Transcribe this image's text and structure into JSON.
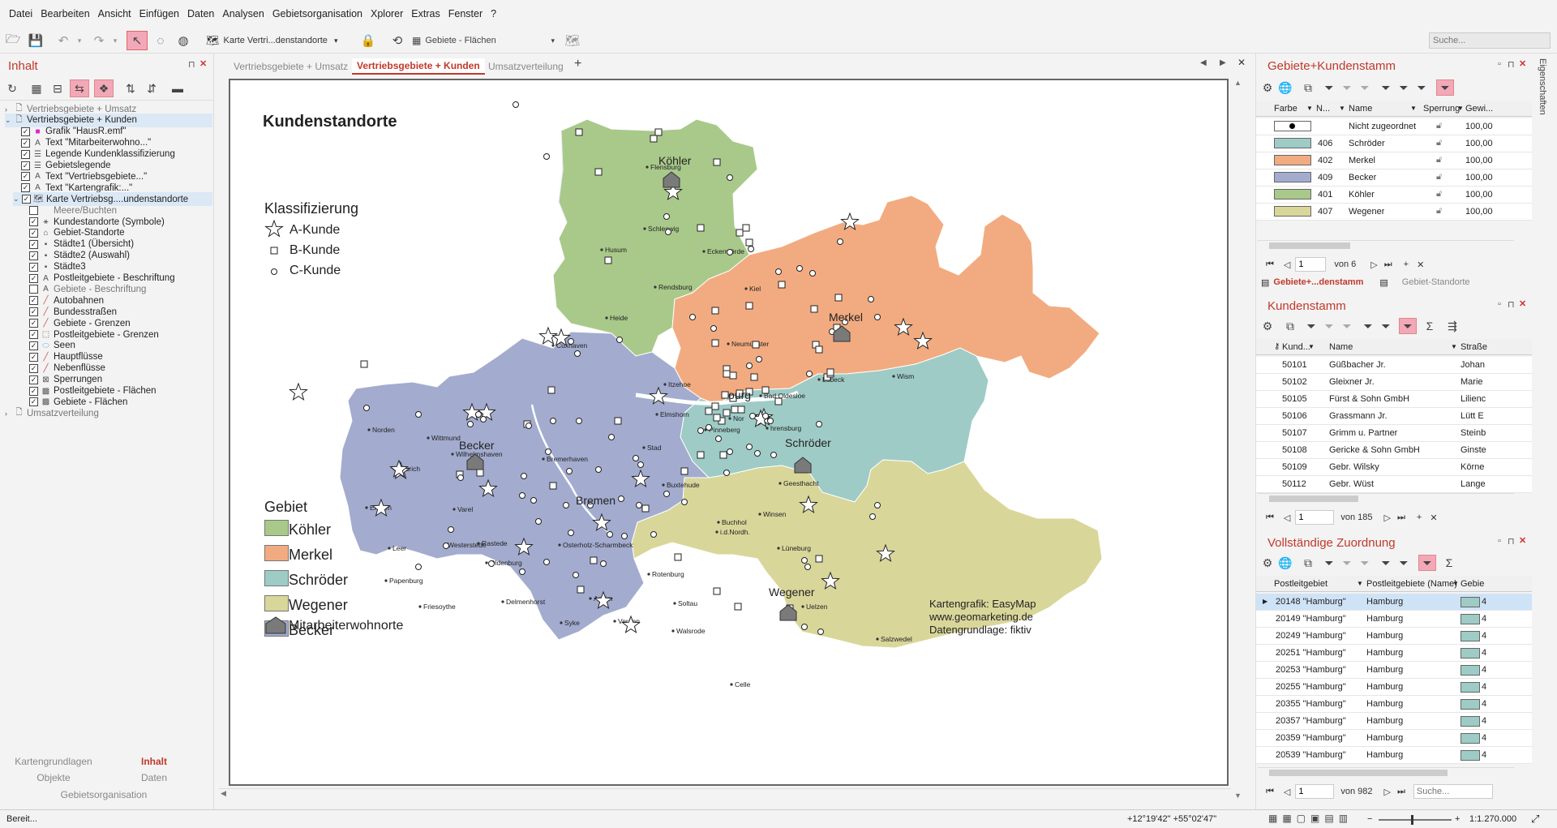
{
  "menu": [
    "Datei",
    "Bearbeiten",
    "Ansicht",
    "Einfügen",
    "Daten",
    "Analysen",
    "Gebietsorganisation",
    "Xplorer",
    "Extras",
    "Fenster",
    "?"
  ],
  "toolbar": {
    "map_dropdown": "Karte Vertri...denstandorte",
    "layer_dropdown": "Gebiete - Flächen",
    "search_placeholder": "Suche..."
  },
  "left_pane": {
    "title": "Inhalt",
    "tree": [
      {
        "label": "Vertriebsgebiete + Umsatz",
        "level": 0,
        "expand": ">",
        "checkbox": false,
        "icon": "page-icon",
        "checked": false,
        "gray": true
      },
      {
        "label": "Vertriebsgebiete + Kunden",
        "level": 0,
        "expand": "v",
        "checkbox": false,
        "icon": "page-icon",
        "checked": false,
        "selected": true
      },
      {
        "label": "Grafik \"HausR.emf\"",
        "level": 1,
        "checkbox": true,
        "checked": true,
        "icon": "graphic-icon"
      },
      {
        "label": "Text \"Mitarbeiterwohno...\"",
        "level": 1,
        "checkbox": true,
        "checked": true,
        "icon": "text-icon"
      },
      {
        "label": "Legende Kundenklassifizierung",
        "level": 1,
        "checkbox": true,
        "checked": true,
        "icon": "legend-icon"
      },
      {
        "label": "Gebietslegende",
        "level": 1,
        "checkbox": true,
        "checked": true,
        "icon": "legend-icon"
      },
      {
        "label": "Text \"Vertriebsgebiete...\"",
        "level": 1,
        "checkbox": true,
        "checked": true,
        "icon": "text-icon"
      },
      {
        "label": "Text \"Kartengrafik:...\"",
        "level": 1,
        "checkbox": true,
        "checked": true,
        "icon": "text-icon"
      },
      {
        "label": "Karte Vertriebsg....undenstandorte",
        "level": 1,
        "expand": "v",
        "checkbox": true,
        "checked": true,
        "icon": "map-icon",
        "selected": true
      },
      {
        "label": "Meere/Buchten",
        "level": 2,
        "checkbox": true,
        "checked": false,
        "icon": "blank-icon",
        "gray": true
      },
      {
        "label": "Kundestandorte (Symbole)",
        "level": 2,
        "checkbox": true,
        "checked": true,
        "icon": "symbol-icon"
      },
      {
        "label": "Gebiet-Standorte",
        "level": 2,
        "checkbox": true,
        "checked": true,
        "icon": "house-icon"
      },
      {
        "label": "Städte1 (Übersicht)",
        "level": 2,
        "checkbox": true,
        "checked": true,
        "icon": "city-icon"
      },
      {
        "label": "Städte2 (Auswahl)",
        "level": 2,
        "checkbox": true,
        "checked": true,
        "icon": "city-icon"
      },
      {
        "label": "Städte3",
        "level": 2,
        "checkbox": true,
        "checked": true,
        "icon": "city-icon"
      },
      {
        "label": "Postleitgebiete - Beschriftung",
        "level": 2,
        "checkbox": true,
        "checked": true,
        "icon": "label-icon"
      },
      {
        "label": "Gebiete - Beschriftung",
        "level": 2,
        "checkbox": true,
        "checked": false,
        "icon": "label-icon",
        "gray": true
      },
      {
        "label": "Autobahnen",
        "level": 2,
        "checkbox": true,
        "checked": true,
        "icon": "line-icon"
      },
      {
        "label": "Bundesstraßen",
        "level": 2,
        "checkbox": true,
        "checked": true,
        "icon": "line-icon"
      },
      {
        "label": "Gebiete - Grenzen",
        "level": 2,
        "checkbox": true,
        "checked": true,
        "icon": "line-icon"
      },
      {
        "label": "Postleitgebiete - Grenzen",
        "level": 2,
        "checkbox": true,
        "checked": true,
        "icon": "border-icon"
      },
      {
        "label": "Seen",
        "level": 2,
        "checkbox": true,
        "checked": true,
        "icon": "lake-icon"
      },
      {
        "label": "Hauptflüsse",
        "level": 2,
        "checkbox": true,
        "checked": true,
        "icon": "line-icon"
      },
      {
        "label": "Nebenflüsse",
        "level": 2,
        "checkbox": true,
        "checked": true,
        "icon": "line-icon"
      },
      {
        "label": "Sperrungen",
        "level": 2,
        "checkbox": true,
        "checked": true,
        "icon": "block-icon"
      },
      {
        "label": "Postleitgebiete - Flächen",
        "level": 2,
        "checkbox": true,
        "checked": true,
        "icon": "area-icon"
      },
      {
        "label": "Gebiete - Flächen",
        "level": 2,
        "checkbox": true,
        "checked": true,
        "icon": "area-icon"
      },
      {
        "label": "Umsatzverteilung",
        "level": 0,
        "expand": ">",
        "checkbox": false,
        "icon": "page-icon",
        "checked": false,
        "gray": true
      }
    ],
    "bottom_tabs": [
      "Kartengrundlagen",
      "Inhalt",
      "Objekte",
      "Daten",
      "Gebietsorganisation"
    ]
  },
  "doc_tabs": [
    "Vertriebsgebiete + Umsatz",
    "Vertriebsgebiete + Kunden",
    "Umsatzverteilung"
  ],
  "map": {
    "title": "Kundenstandorte",
    "klass_title": "Klassifizierung",
    "klass": [
      "A-Kunde",
      "B-Kunde",
      "C-Kunde"
    ],
    "gebiet_title": "Gebiet",
    "gebiete": [
      {
        "name": "Köhler",
        "color": "#a9c98a"
      },
      {
        "name": "Merkel",
        "color": "#f2ab80"
      },
      {
        "name": "Schröder",
        "color": "#9ecbc6"
      },
      {
        "name": "Wegener",
        "color": "#d9d69a"
      },
      {
        "name": "Becker",
        "color": "#a3accf"
      }
    ],
    "mitarbeiter": "Mitarbeiterwohnorte",
    "credits": [
      "Kartengrafik: EasyMap",
      "www.geomarketing.de",
      "Datengrundlage: fiktiv"
    ],
    "terr_labels": {
      "koehler": "Köhler",
      "merkel": "Merkel",
      "schroeder": "Schröder",
      "wegener": "Wegener",
      "becker": "Becker",
      "bremen": "Bremen",
      "hamburg": "ourg"
    },
    "cities": {
      "flensburg": "Flensburg",
      "schleswig": "Schleswig",
      "husum": "Husum",
      "eckernfoerde": "Eckernförde",
      "rendsburg": "Rendsburg",
      "heide": "Heide",
      "kiel": "Kiel",
      "neumuenster": "Neumünster",
      "itzehoe": "Itzehoe",
      "badoldesloe": "Bad Oldesloe",
      "luebeck": "Lübeck",
      "wismar": "Wism",
      "elmshorn": "Elmshorn",
      "norderstedt": "Nor",
      "ahrensburg": "hrensburg",
      "pinneberg": "Pinneberg",
      "stade": "Stad",
      "buxtehude": "Buxtehude",
      "geesthacht": "Geesthacht",
      "winsen": "Winsen",
      "buchholz1": "Buchhol",
      "buchholz2": "i.d.Nordh.",
      "lueneburg": "Lüneburg",
      "cuxhaven": "Cuxhaven",
      "bremerhaven": "Bremerhaven",
      "wilhelmshaven": "Wilhelmshaven",
      "norden": "Norden",
      "wittmund": "Wittmund",
      "aurich": "Aurich",
      "emden": "Emden",
      "varel": "Varel",
      "leer": "Leer",
      "westerstede": "Westerstede",
      "rastede": "Rastede",
      "oldenburg": "Oldenburg",
      "osterholz": "Osterholz-Scharmbeck",
      "papenburg": "Papenburg",
      "friesoythe": "Friesoythe",
      "delmenhorst": "Delmenhorst",
      "achim": "Achim",
      "syke": "Syke",
      "verden": "Verden",
      "rotenburg": "Rotenburg",
      "soltau": "Soltau",
      "walsrode": "Walsrode",
      "uelzen": "Uelzen",
      "salzwedel": "Salzwedel",
      "celle": "Celle"
    }
  },
  "pane1": {
    "title": "Gebiete+Kundenstamm",
    "columns": [
      "Farbe",
      "N...",
      "Name",
      "Sperrung",
      "Gewi..."
    ],
    "rows": [
      {
        "nr": "",
        "name": "Nicht zugeordnet",
        "gew": "100,00",
        "color": "#ffffff",
        "dot": true
      },
      {
        "nr": "406",
        "name": "Schröder",
        "gew": "100,00",
        "color": "#9ecbc6"
      },
      {
        "nr": "402",
        "name": "Merkel",
        "gew": "100,00",
        "color": "#f2ab80"
      },
      {
        "nr": "409",
        "name": "Becker",
        "gew": "100,00",
        "color": "#a3accf"
      },
      {
        "nr": "401",
        "name": "Köhler",
        "gew": "100,00",
        "color": "#a9c98a"
      },
      {
        "nr": "407",
        "name": "Wegener",
        "gew": "100,00",
        "color": "#d9d69a"
      }
    ],
    "page": "1",
    "of": "von 6",
    "tabs": [
      "Gebiete+...denstamm",
      "Gebiet-Standorte"
    ]
  },
  "pane2": {
    "title": "Kundenstamm",
    "columns": [
      "Kund...",
      "Name",
      "Straße"
    ],
    "rows": [
      {
        "id": "50101",
        "name": "Güßbacher Jr.",
        "street": "Johan"
      },
      {
        "id": "50102",
        "name": "Gleixner Jr.",
        "street": "Marie"
      },
      {
        "id": "50105",
        "name": "Fürst & Sohn GmbH",
        "street": "Lilienc"
      },
      {
        "id": "50106",
        "name": "Grassmann Jr.",
        "street": "Lütt E"
      },
      {
        "id": "50107",
        "name": "Grimm u. Partner",
        "street": "Steinb"
      },
      {
        "id": "50108",
        "name": "Gericke & Sohn GmbH",
        "street": "Ginste"
      },
      {
        "id": "50109",
        "name": "Gebr. Wilsky",
        "street": "Körne"
      },
      {
        "id": "50112",
        "name": "Gebr. Wüst",
        "street": "Lange"
      }
    ],
    "page": "1",
    "of": "von 185"
  },
  "pane3": {
    "title": "Vollständige Zuordnung",
    "columns": [
      "Postleitgebiet",
      "Postleitgebiete (Name)",
      "Gebie"
    ],
    "rows": [
      {
        "plz": "20148 \"Hamburg\"",
        "name": "Hamburg",
        "g": "4",
        "selected": true
      },
      {
        "plz": "20149 \"Hamburg\"",
        "name": "Hamburg",
        "g": "4"
      },
      {
        "plz": "20249 \"Hamburg\"",
        "name": "Hamburg",
        "g": "4"
      },
      {
        "plz": "20251 \"Hamburg\"",
        "name": "Hamburg",
        "g": "4"
      },
      {
        "plz": "20253 \"Hamburg\"",
        "name": "Hamburg",
        "g": "4"
      },
      {
        "plz": "20255 \"Hamburg\"",
        "name": "Hamburg",
        "g": "4"
      },
      {
        "plz": "20355 \"Hamburg\"",
        "name": "Hamburg",
        "g": "4"
      },
      {
        "plz": "20357 \"Hamburg\"",
        "name": "Hamburg",
        "g": "4"
      },
      {
        "plz": "20359 \"Hamburg\"",
        "name": "Hamburg",
        "g": "4"
      },
      {
        "plz": "20539 \"Hamburg\"",
        "name": "Hamburg",
        "g": "4"
      }
    ],
    "page": "1",
    "of": "von 982",
    "search_placeholder": "Suche..."
  },
  "side_tab": "Eigenschaften",
  "status": {
    "text": "Bereit...",
    "coords": "+12°19'42\" +55°02'47\"",
    "scale": "1:1.270.000"
  }
}
